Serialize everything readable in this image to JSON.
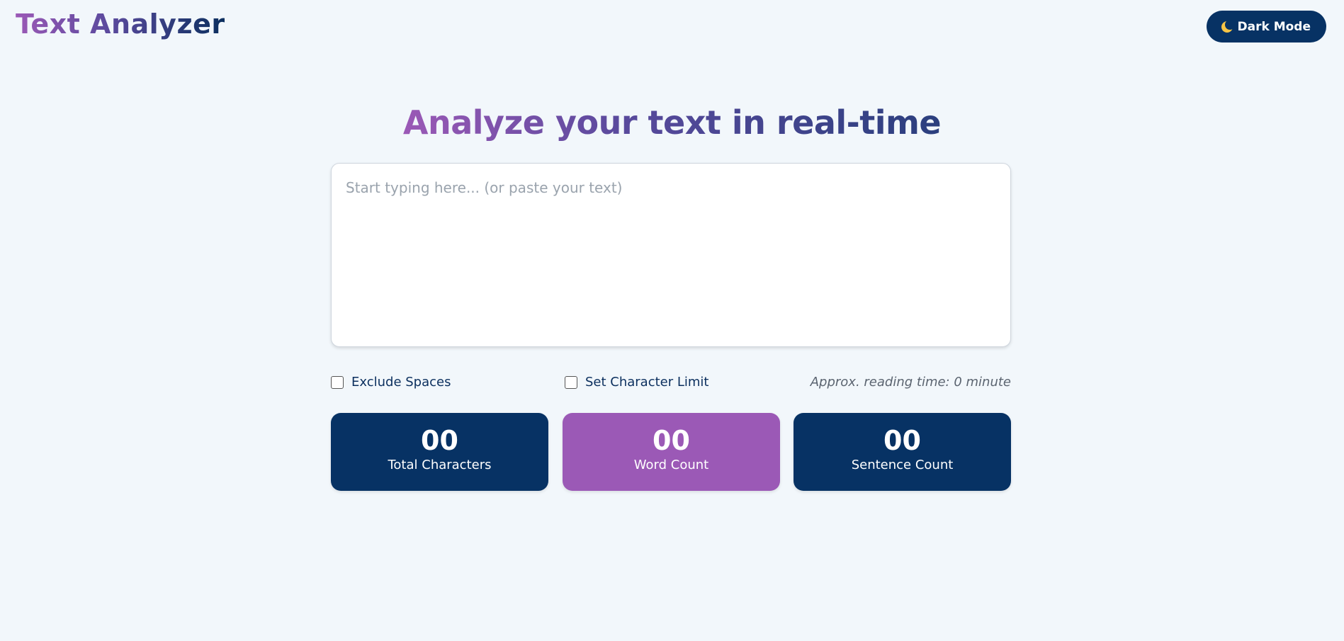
{
  "header": {
    "brand": "Text Analyzer",
    "theme_toggle_label": "Dark Mode",
    "theme_toggle_icon": "moon-icon"
  },
  "main": {
    "heading": "Analyze your text in real-time",
    "textarea": {
      "value": "",
      "placeholder": "Start typing here... (or paste your text)"
    },
    "options": {
      "exclude_spaces_label": "Exclude Spaces",
      "exclude_spaces_checked": false,
      "char_limit_label": "Set Character Limit",
      "char_limit_checked": false,
      "reading_time": "Approx. reading time: 0 minute"
    },
    "stats": [
      {
        "value": "00",
        "label": "Total Characters",
        "color": "#073264"
      },
      {
        "value": "00",
        "label": "Word Count",
        "color": "#9b59b6"
      },
      {
        "value": "00",
        "label": "Sentence Count",
        "color": "#073264"
      }
    ]
  },
  "colors": {
    "background": "#f2f7fb",
    "navy": "#073264",
    "purple": "#9b59b6"
  }
}
